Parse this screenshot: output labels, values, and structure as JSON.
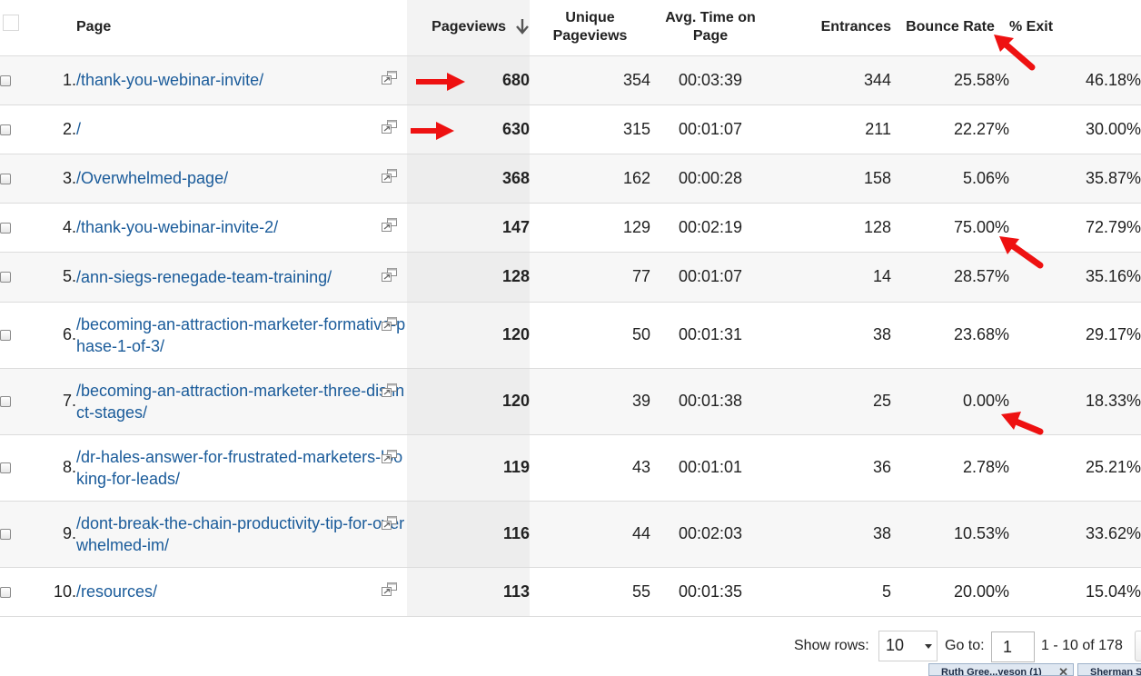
{
  "table": {
    "headers": {
      "page": "Page",
      "pageviews": "Pageviews",
      "unique_pageviews_line1": "Unique",
      "unique_pageviews_line2": "Pageviews",
      "avg_time_line1": "Avg. Time on",
      "avg_time_line2": "Page",
      "entrances": "Entrances",
      "bounce_rate": "Bounce Rate",
      "exit": "% Exit"
    },
    "rows": [
      {
        "num": "1.",
        "page": "/thank-you-webinar-invite/",
        "pageviews": "680",
        "unique_pageviews": "354",
        "avg_time": "00:03:39",
        "entrances": "344",
        "bounce_rate": "25.58%",
        "exit": "46.18%"
      },
      {
        "num": "2.",
        "page": "/",
        "pageviews": "630",
        "unique_pageviews": "315",
        "avg_time": "00:01:07",
        "entrances": "211",
        "bounce_rate": "22.27%",
        "exit": "30.00%"
      },
      {
        "num": "3.",
        "page": "/Overwhelmed-page/",
        "pageviews": "368",
        "unique_pageviews": "162",
        "avg_time": "00:00:28",
        "entrances": "158",
        "bounce_rate": "5.06%",
        "exit": "35.87%"
      },
      {
        "num": "4.",
        "page": "/thank-you-webinar-invite-2/",
        "pageviews": "147",
        "unique_pageviews": "129",
        "avg_time": "00:02:19",
        "entrances": "128",
        "bounce_rate": "75.00%",
        "exit": "72.79%"
      },
      {
        "num": "5.",
        "page": "/ann-siegs-renegade-team-training/",
        "pageviews": "128",
        "unique_pageviews": "77",
        "avg_time": "00:01:07",
        "entrances": "14",
        "bounce_rate": "28.57%",
        "exit": "35.16%"
      },
      {
        "num": "6.",
        "page": "/becoming-an-attraction-marketer-formative-phase-1-of-3/",
        "pageviews": "120",
        "unique_pageviews": "50",
        "avg_time": "00:01:31",
        "entrances": "38",
        "bounce_rate": "23.68%",
        "exit": "29.17%"
      },
      {
        "num": "7.",
        "page": "/becoming-an-attraction-marketer-three-distinct-stages/",
        "pageviews": "120",
        "unique_pageviews": "39",
        "avg_time": "00:01:38",
        "entrances": "25",
        "bounce_rate": "0.00%",
        "exit": "18.33%"
      },
      {
        "num": "8.",
        "page": "/dr-hales-answer-for-frustrated-marketers-looking-for-leads/",
        "pageviews": "119",
        "unique_pageviews": "43",
        "avg_time": "00:01:01",
        "entrances": "36",
        "bounce_rate": "2.78%",
        "exit": "25.21%"
      },
      {
        "num": "9.",
        "page": "/dont-break-the-chain-productivity-tip-for-overwhelmed-im/",
        "pageviews": "116",
        "unique_pageviews": "44",
        "avg_time": "00:02:03",
        "entrances": "38",
        "bounce_rate": "10.53%",
        "exit": "33.62%"
      },
      {
        "num": "10.",
        "page": "/resources/",
        "pageviews": "113",
        "unique_pageviews": "55",
        "avg_time": "00:01:35",
        "entrances": "5",
        "bounce_rate": "20.00%",
        "exit": "15.04%"
      }
    ]
  },
  "pagination": {
    "show_rows_label": "Show rows:",
    "show_rows_value": "10",
    "goto_label": "Go to:",
    "goto_value": "1",
    "range_text": "1 - 10 of 178"
  },
  "taskbar": {
    "tabs": [
      {
        "label": "Ruth Gree...yeson (1)"
      },
      {
        "label": "Sherman S"
      }
    ]
  },
  "icons": {
    "sort": "arrow-down-icon",
    "open_page": "open-page-icon",
    "annotation": "red-arrow-icon"
  },
  "colors": {
    "link": "#1a5b9a",
    "annotation_arrow": "#ee1111",
    "highlight_column": "#ededed"
  }
}
